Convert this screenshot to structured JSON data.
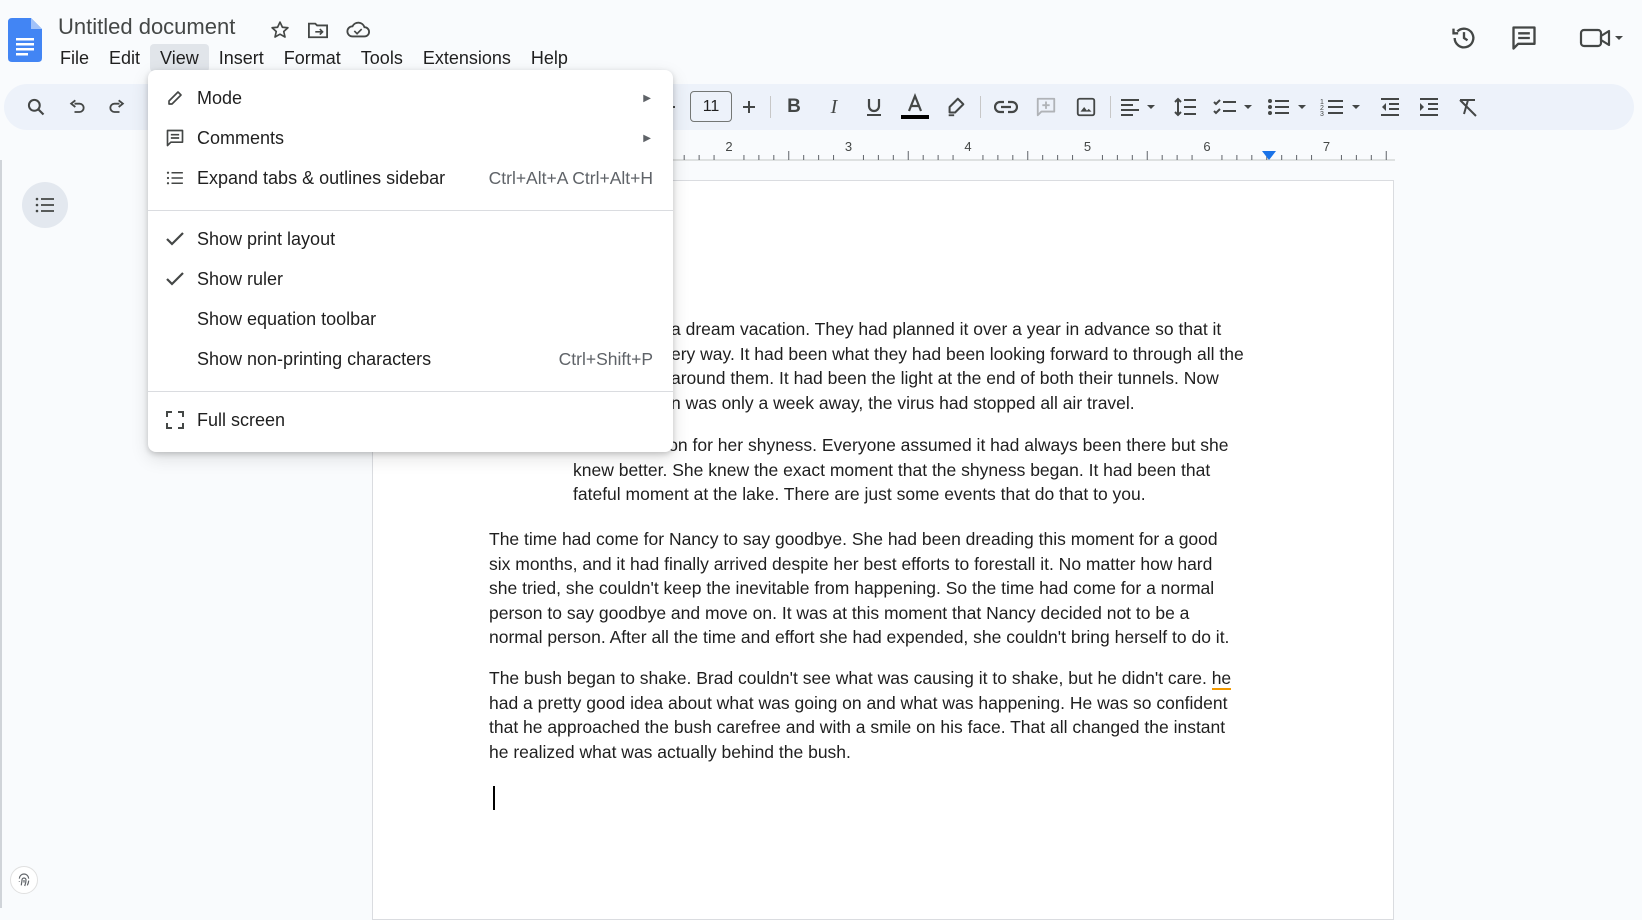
{
  "header": {
    "title": "Untitled document",
    "menus": [
      "File",
      "Edit",
      "View",
      "Insert",
      "Format",
      "Tools",
      "Extensions",
      "Help"
    ],
    "active_menu": "View"
  },
  "toolbar": {
    "font_size": "11"
  },
  "ruler": {
    "numbers": [
      "2",
      "3",
      "4",
      "5",
      "6",
      "7"
    ]
  },
  "view_menu": {
    "mode": "Mode",
    "comments": "Comments",
    "expand_tabs": "Expand tabs & outlines sidebar",
    "expand_tabs_shortcut": "Ctrl+Alt+A Ctrl+Alt+H",
    "show_print_layout": "Show print layout",
    "show_ruler": "Show ruler",
    "show_equation_toolbar": "Show equation toolbar",
    "show_non_printing": "Show non-printing characters",
    "show_non_printing_shortcut": "Ctrl+Shift+P",
    "full_screen": "Full screen"
  },
  "document": {
    "p1": [
      "a dream vacation. They had planned it over a year in advance so that it",
      "ery way. It had been what they had been looking forward to through all the",
      "around them. It had been the light at the end of both their tunnels. Now",
      "n was only a week away, the virus had stopped all air travel."
    ],
    "p2": [
      "There was a reason for her shyness. Everyone assumed it had always been there but she",
      "knew better. She knew the exact moment that the shyness began. It had been that",
      "fateful moment at the lake. There are just some events that do that to you."
    ],
    "p3": [
      "The time had come for Nancy to say goodbye. She had been dreading this moment for a good",
      "six months, and it had finally arrived despite her best efforts to forestall it. No matter how hard",
      "she tried, she couldn't keep the inevitable from happening. So the time had come for a normal",
      "person to say goodbye and move on. It was at this moment that Nancy decided not to be a",
      "normal person. After all the time and effort she had expended, she couldn't bring herself to do it."
    ],
    "p4_line1": "The bush began to shake. Brad couldn't see what was causing it to shake, but he didn't care.",
    "p4_line1_flagged": "he",
    "p4": [
      "had a pretty good idea about what was going on and what was happening. He was so confident",
      "that he approached the bush carefree and with a smile on his face. That all changed the instant",
      "he realized what was actually behind the bush."
    ]
  }
}
